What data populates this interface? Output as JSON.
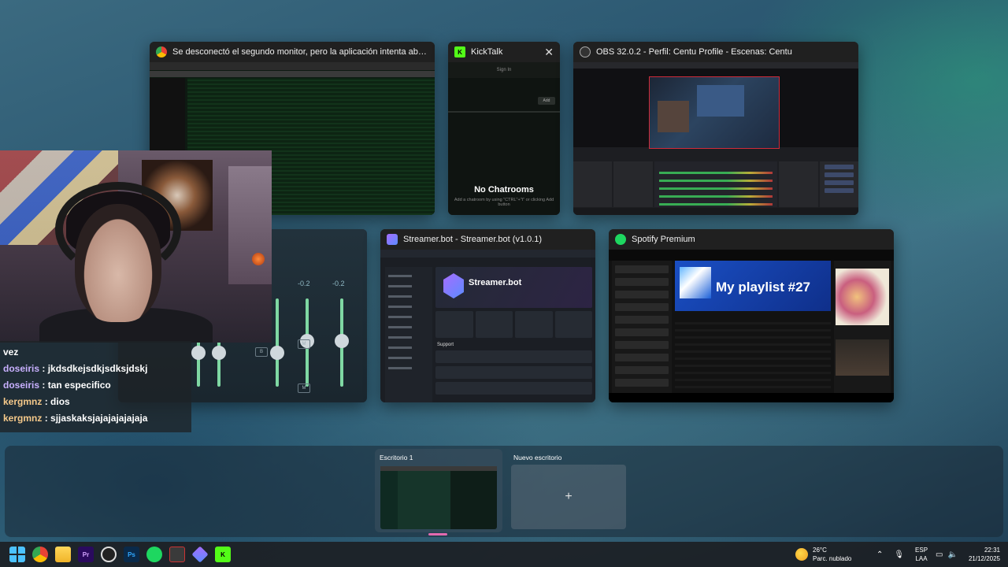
{
  "windows": {
    "chrome": {
      "title": "Se desconectó el segundo monitor, pero la aplicación intenta abrirse ahí. : r/vmware - Go...",
      "icon": "chrome-icon"
    },
    "kicktalk": {
      "title": "KickTalk",
      "close": "✕",
      "empty_title": "No Chatrooms",
      "empty_hint": "Add a chatroom by using \"CTRL\"+\"t\" or clicking Add button",
      "sign_in": "Sign In",
      "add": "Add"
    },
    "obs": {
      "title": "OBS 32.0.2 - Perfil: Centu Profile - Escenas: Centu"
    },
    "streamerbot": {
      "title": "Streamer.bot - Streamer.bot (v1.0.1)",
      "brand": "Streamer.bot",
      "support": "Support"
    },
    "spotify": {
      "title": "Spotify Premium",
      "playlist": "My playlist #27"
    },
    "mixer": {
      "val_a": "-0.2",
      "val_b": "-0.2",
      "btn_m": "M",
      "btn_b": "B"
    }
  },
  "chat": {
    "lines": [
      {
        "user": "",
        "msg": "vez"
      },
      {
        "user": "doseiris",
        "msg": ": jkdsdkejsdkjsdksjdskj"
      },
      {
        "user": "doseiris",
        "msg": ": tan especifico"
      },
      {
        "user": "kergmnz",
        "msg": ": dios"
      },
      {
        "user": "kergmnz",
        "msg": ": sjjaskaksjajajajajajaja"
      }
    ]
  },
  "desktops": {
    "desk1": "Escritorio 1",
    "desk2": "Nuevo escritorio",
    "add": "+"
  },
  "taskbar": {
    "icons": [
      "windows-start-icon",
      "chrome-icon",
      "file-explorer-icon",
      "premiere-icon",
      "obs-icon",
      "photoshop-icon",
      "spotify-icon",
      "streamdeck-icon",
      "streamerbot-icon",
      "kicktalk-icon"
    ],
    "weather_temp": "26°C",
    "weather_desc": "Parc. nublado",
    "lang1": "ESP",
    "lang2": "LAA",
    "time": "22:31",
    "date": "21/12/2025",
    "colors": {
      "spotify": "#1ed760",
      "kick": "#53fc18",
      "premiere": "#2a0a5e",
      "photoshop": "#0a2a4a"
    }
  }
}
